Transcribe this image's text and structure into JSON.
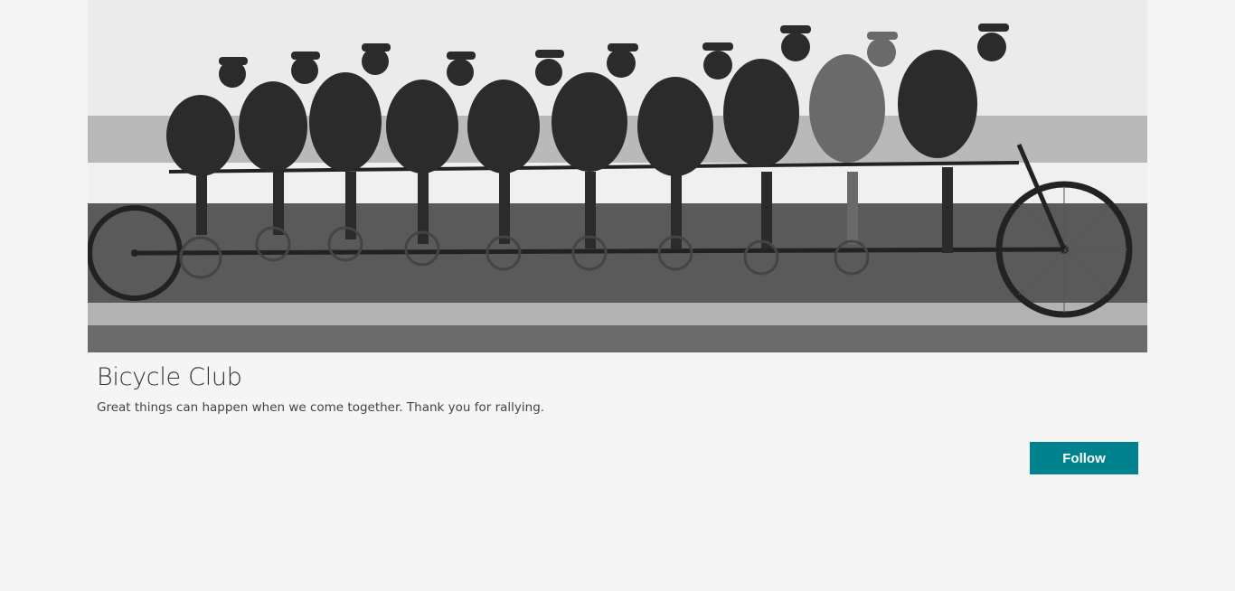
{
  "hero": {
    "image_description_icon": "group-photo-icon"
  },
  "group": {
    "title": "Bicycle Club",
    "tagline": "Great things can happen when we come together. Thank you for rallying."
  },
  "actions": {
    "follow_label": "Follow"
  },
  "colors": {
    "background": "#f5f5f5",
    "accent": "#00838f"
  }
}
